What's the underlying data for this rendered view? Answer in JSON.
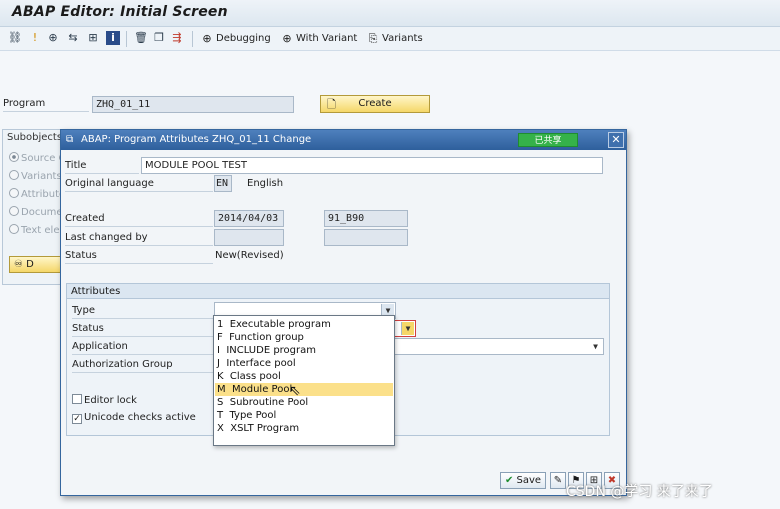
{
  "window": {
    "title": "ABAP Editor: Initial Screen"
  },
  "toolbar": {
    "icons": [
      "hierarchy-icon",
      "exclamation-icon",
      "execute-icon",
      "where-used-icon",
      "tree-icon",
      "info-icon",
      "delete-icon",
      "copy-icon",
      "rename-icon"
    ],
    "debugging_label": "Debugging",
    "with_variant_label": "With Variant",
    "variants_label": "Variants"
  },
  "main": {
    "program_label": "Program",
    "program_value": "ZHQ_01_11",
    "create_label": "Create",
    "subobjects_label": "Subobjects",
    "subobjects": [
      {
        "label": "Source C",
        "selected": true
      },
      {
        "label": "Variants",
        "selected": false
      },
      {
        "label": "Attribute",
        "selected": false
      },
      {
        "label": "Docume",
        "selected": false
      },
      {
        "label": "Text ele",
        "selected": false
      }
    ],
    "display_btn_label": "D"
  },
  "dialog": {
    "title": "ABAP: Program Attributes ZHQ_01_11 Change",
    "share_label": "已共享",
    "close_label": "✕",
    "title_label": "Title",
    "title_value": "MODULE POOL TEST",
    "orig_lang_label": "Original language",
    "orig_lang_code": "EN",
    "orig_lang_name": "English",
    "created_label": "Created",
    "created_date": "2014/04/03",
    "created_user": "91_B90",
    "last_changed_label": "Last changed by",
    "status_label": "Status",
    "status_value": "New(Revised)",
    "attributes_header": "Attributes",
    "type_label": "Type",
    "status_attr_label": "Status",
    "application_label": "Application",
    "auth_group_label": "Authorization Group",
    "editor_lock_label": "Editor lock",
    "editor_lock_checked": false,
    "unicode_label": "Unicode checks active",
    "unicode_checked": true,
    "save_label": "Save"
  },
  "type_dropdown": {
    "options": [
      {
        "code": "1",
        "label": "Executable program"
      },
      {
        "code": "F",
        "label": "Function group"
      },
      {
        "code": "I",
        "label": "INCLUDE program"
      },
      {
        "code": "J",
        "label": "Interface pool"
      },
      {
        "code": "K",
        "label": "Class pool"
      },
      {
        "code": "M",
        "label": "Module Pool"
      },
      {
        "code": "S",
        "label": "Subroutine Pool"
      },
      {
        "code": "T",
        "label": "Type Pool"
      },
      {
        "code": "X",
        "label": "XSLT Program"
      }
    ],
    "highlighted": "M"
  },
  "watermark": "CSDN @学习 来了来了",
  "colors": {
    "accent": "#2e5f9c",
    "button_yellow": "#f5d769",
    "selection": "#fbe08a",
    "share_green": "#35b24a"
  }
}
